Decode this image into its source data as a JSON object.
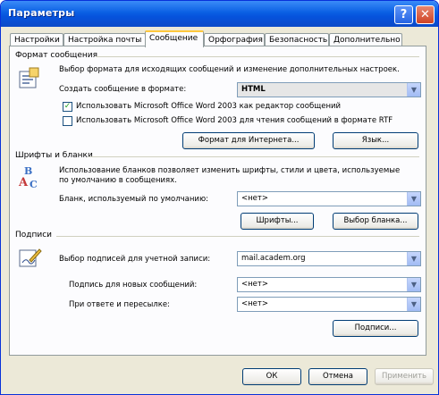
{
  "window": {
    "title": "Параметры"
  },
  "titlebar": {
    "help": "?",
    "close": "✕"
  },
  "tabs": [
    {
      "label": "Настройки"
    },
    {
      "label": "Настройка почты"
    },
    {
      "label": "Сообщение"
    },
    {
      "label": "Орфография"
    },
    {
      "label": "Безопасность"
    },
    {
      "label": "Дополнительно"
    }
  ],
  "format": {
    "section": "Формат сообщения",
    "desc": "Выбор формата для исходящих сообщений и изменение дополнительных настроек.",
    "compose_label": "Создать сообщение в формате:",
    "compose_value": "HTML",
    "check1": "Использовать Microsoft Office Word 2003 как редактор сообщений",
    "check2": "Использовать Microsoft Office Word 2003 для чтения сообщений в формате RTF",
    "internet_btn": "Формат для Интернета...",
    "lang_btn": "Язык..."
  },
  "fonts": {
    "section": "Шрифты и бланки",
    "desc1": "Использование бланков позволяет изменить шрифты, стили и цвета, используемые",
    "desc2": "по умолчанию в сообщениях.",
    "stationery_label": "Бланк, используемый по умолчанию:",
    "stationery_value": "<нет>",
    "fonts_btn": "Шрифты...",
    "choose_btn": "Выбор бланка..."
  },
  "signatures": {
    "section": "Подписи",
    "account_label": "Выбор подписей для учетной записи:",
    "account_value": "mail.academ.org",
    "new_label": "Подпись для новых сообщений:",
    "new_value": "<нет>",
    "reply_label": "При ответе и пересылке:",
    "reply_value": "<нет>",
    "sig_btn": "Подписи..."
  },
  "footer": {
    "ok": "ОК",
    "cancel": "Отмена",
    "apply": "Применить"
  }
}
